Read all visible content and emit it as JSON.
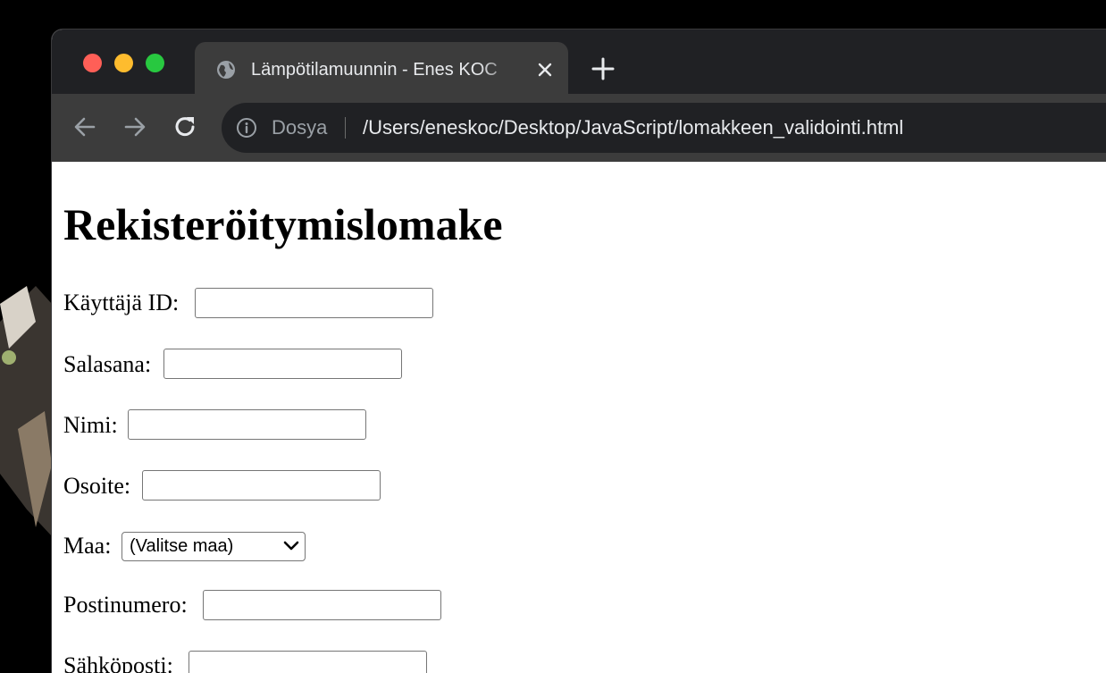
{
  "browser": {
    "tab": {
      "title": "Lämpötilamuunnin - Enes KOC"
    },
    "omnibox": {
      "scheme_label": "Dosya",
      "url": "/Users/eneskoc/Desktop/JavaScript/lomakkeen_validointi.html"
    }
  },
  "page": {
    "title": "Rekisteröitymislomake",
    "fields": {
      "user_id": {
        "label": "Käyttäjä ID:",
        "value": ""
      },
      "password": {
        "label": "Salasana:",
        "value": ""
      },
      "name": {
        "label": "Nimi:",
        "value": ""
      },
      "address": {
        "label": "Osoite:",
        "value": ""
      },
      "country": {
        "label": "Maa:",
        "selected": "(Valitse maa)"
      },
      "postal_code": {
        "label": "Postinumero:",
        "value": ""
      },
      "email": {
        "label": "Sähköposti:",
        "value": ""
      }
    }
  },
  "icons": {
    "traffic_lights": [
      "close-icon",
      "minimize-icon",
      "maximize-icon"
    ],
    "tab_favicon": "globe-icon",
    "tab_close": "close-icon",
    "new_tab": "plus-icon",
    "back": "arrow-left-icon",
    "forward": "arrow-right-icon",
    "reload": "reload-icon",
    "info": "info-icon",
    "select": "chevron-down-icon"
  },
  "colors": {
    "traffic_red": "#ff5f57",
    "traffic_yellow": "#febc2e",
    "traffic_green": "#28c840",
    "tabstrip": "#202124",
    "toolbar": "#3c3c3c"
  }
}
